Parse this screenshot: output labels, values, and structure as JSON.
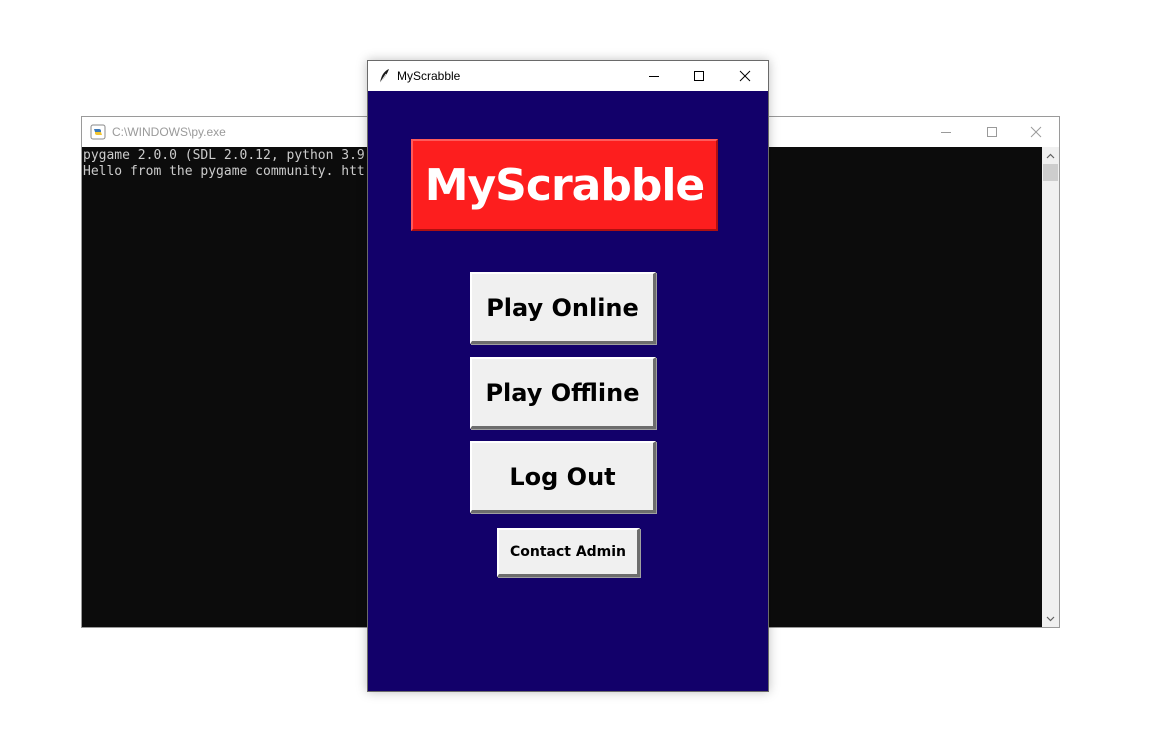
{
  "console_window": {
    "title": "C:\\WINDOWS\\py.exe",
    "lines": [
      "pygame 2.0.0 (SDL 2.0.12, python 3.9",
      "Hello from the pygame community. htt"
    ]
  },
  "app_window": {
    "title": "MyScrabble",
    "background_color": "#12006a",
    "logo_text": "MyScrabble",
    "logo_color": "#fd1e1e",
    "buttons": {
      "play_online": "Play Online",
      "play_offline": "Play Offline",
      "log_out": "Log Out",
      "contact_admin": "Contact Admin"
    }
  },
  "icons": {
    "console_app": "python-icon",
    "app": "feather-icon",
    "minimize": "minimize-icon",
    "maximize": "maximize-icon",
    "close": "close-icon",
    "scroll_up": "chevron-up-icon",
    "scroll_down": "chevron-down-icon"
  }
}
